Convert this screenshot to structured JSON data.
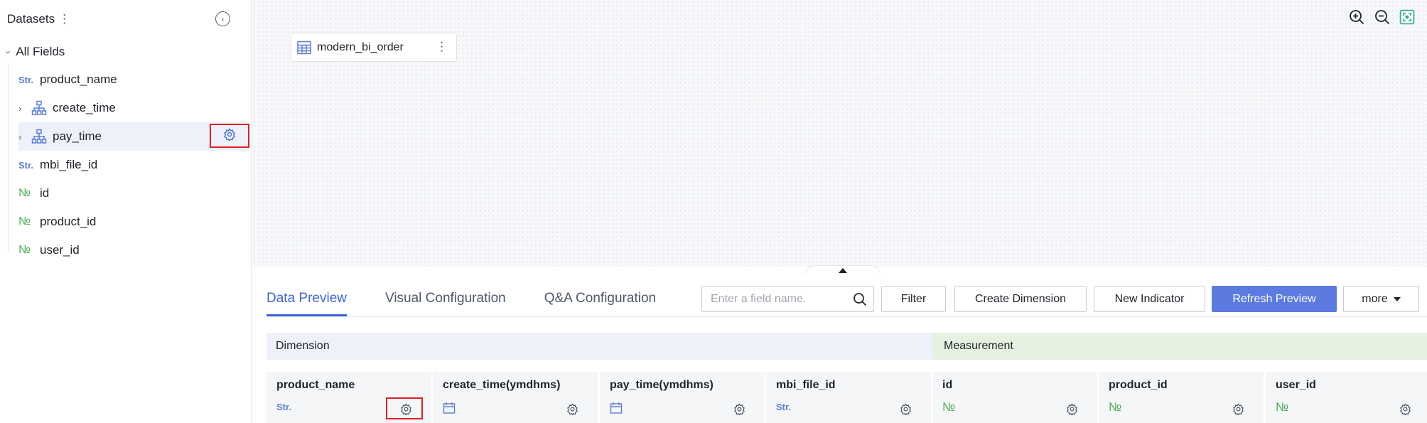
{
  "left_panel": {
    "title": "Datasets",
    "kebab_glyph": "⋮",
    "collapse_glyph": "‹",
    "all_fields_label": "All Fields",
    "fields": [
      {
        "type": "Str.",
        "name": "product_name"
      },
      {
        "type": "hierarchy-icon",
        "name": "create_time"
      },
      {
        "type": "hierarchy-icon",
        "name": "pay_time"
      },
      {
        "type": "Str.",
        "name": "mbi_file_id"
      },
      {
        "type": "№",
        "name": "id"
      },
      {
        "type": "№",
        "name": "product_id"
      },
      {
        "type": "№",
        "name": "user_id"
      }
    ]
  },
  "canvas": {
    "table_node": {
      "label": "modern_bi_order",
      "icon": "table-icon",
      "kebab_glyph": "⋮"
    },
    "tools": [
      "zoom-in-icon",
      "zoom-out-icon",
      "fit-screen-icon"
    ]
  },
  "bottom": {
    "tabs": [
      {
        "label": "Data Preview",
        "active": true
      },
      {
        "label": "Visual Configuration",
        "active": false
      },
      {
        "label": "Q&A Configuration",
        "active": false
      }
    ],
    "search_placeholder": "Enter a field name.",
    "buttons": {
      "filter": "Filter",
      "create_dimension": "Create Dimension",
      "new_indicator": "New Indicator",
      "refresh_preview": "Refresh Preview",
      "more": "more"
    },
    "groups": {
      "dimension": "Dimension",
      "measurement": "Measurement"
    },
    "columns": [
      {
        "title": "product_name",
        "type": "Str."
      },
      {
        "title": "create_time(ymdhms)",
        "type": "calendar-icon"
      },
      {
        "title": "pay_time(ymdhms)",
        "type": "calendar-icon"
      },
      {
        "title": "mbi_file_id",
        "type": "Str."
      },
      {
        "title": "id",
        "type": "№"
      },
      {
        "title": "product_id",
        "type": "№"
      },
      {
        "title": "user_id",
        "type": "№"
      }
    ]
  },
  "colors": {
    "accent": "#3f66d6",
    "primary_button": "#5b7be0",
    "highlight_box": "#e02020",
    "dimension_bg": "#eef1fa",
    "measurement_bg": "#e6f2e1",
    "string_type": "#5a7fd6",
    "number_type": "#4caf50"
  }
}
